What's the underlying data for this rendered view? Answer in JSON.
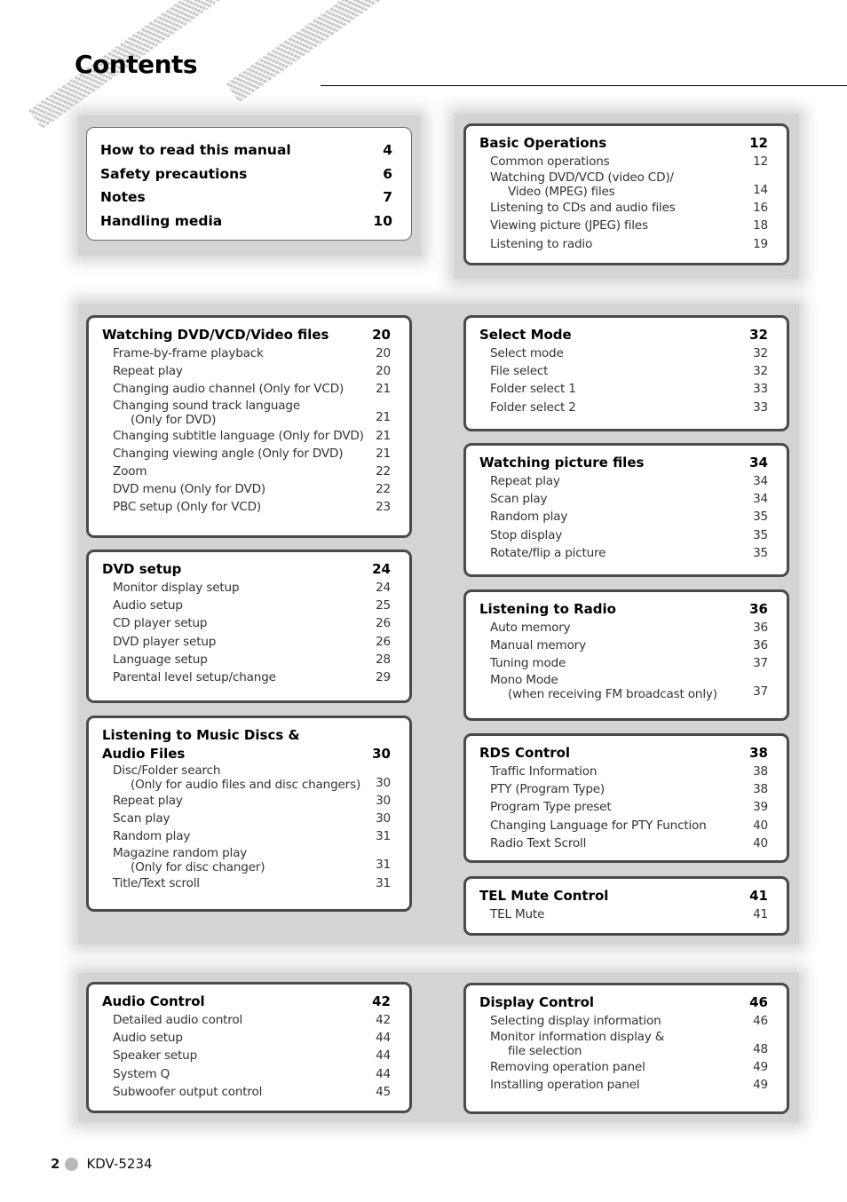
{
  "page": {
    "title": "Contents",
    "footer": {
      "page_number": "2",
      "model": "KDV-5234"
    }
  },
  "intro": [
    {
      "label": "How to read this manual",
      "page": "4"
    },
    {
      "label": "Safety precautions",
      "page": "6"
    },
    {
      "label": "Notes",
      "page": "7"
    },
    {
      "label": "Handling media",
      "page": "10"
    }
  ],
  "sections": {
    "basic": {
      "title": "Basic Operations",
      "page": "12",
      "items": [
        {
          "label": "Common operations",
          "page": "12"
        },
        {
          "label": "Watching DVD/VCD (video CD)/",
          "sub": "Video (MPEG) files",
          "page": "14"
        },
        {
          "label": "Listening to CDs and audio files",
          "page": "16"
        },
        {
          "label": "Viewing picture (JPEG) files",
          "page": "18"
        },
        {
          "label": "Listening to radio",
          "page": "19"
        }
      ]
    },
    "watching_dvd": {
      "title": "Watching DVD/VCD/Video files",
      "page": "20",
      "items": [
        {
          "label": "Frame-by-frame playback",
          "page": "20"
        },
        {
          "label": "Repeat play",
          "page": "20"
        },
        {
          "label": "Changing audio channel (Only for VCD)",
          "page": "21"
        },
        {
          "label": "Changing sound track language",
          "sub": "(Only for DVD)",
          "page": "21"
        },
        {
          "label": "Changing subtitle language (Only for DVD)",
          "page": "21"
        },
        {
          "label": "Changing viewing angle (Only for DVD)",
          "page": "21"
        },
        {
          "label": "Zoom",
          "page": "22"
        },
        {
          "label": "DVD menu (Only for DVD)",
          "page": "22"
        },
        {
          "label": "PBC setup (Only for VCD)",
          "page": "23"
        }
      ]
    },
    "dvd_setup": {
      "title": "DVD setup",
      "page": "24",
      "items": [
        {
          "label": "Monitor display setup",
          "page": "24"
        },
        {
          "label": "Audio setup",
          "page": "25"
        },
        {
          "label": "CD player setup",
          "page": "26"
        },
        {
          "label": "DVD player setup",
          "page": "26"
        },
        {
          "label": "Language setup",
          "page": "28"
        },
        {
          "label": "Parental level setup/change",
          "page": "29"
        }
      ]
    },
    "music": {
      "title_line1": "Listening to Music Discs &",
      "title": "Audio Files",
      "page": "30",
      "items": [
        {
          "label": "Disc/Folder search",
          "sub": "(Only for audio files and disc changers)",
          "page": "30"
        },
        {
          "label": "Repeat play",
          "page": "30"
        },
        {
          "label": "Scan play",
          "page": "30"
        },
        {
          "label": "Random play",
          "page": "31"
        },
        {
          "label": "Magazine random play",
          "sub": "(Only for disc changer)",
          "page": "31"
        },
        {
          "label": "Title/Text scroll",
          "page": "31"
        }
      ]
    },
    "select_mode": {
      "title": "Select Mode",
      "page": "32",
      "items": [
        {
          "label": "Select mode",
          "page": "32"
        },
        {
          "label": "File select",
          "page": "32"
        },
        {
          "label": "Folder select 1",
          "page": "33"
        },
        {
          "label": "Folder select 2",
          "page": "33"
        }
      ]
    },
    "picture": {
      "title": "Watching picture files",
      "page": "34",
      "items": [
        {
          "label": "Repeat play",
          "page": "34"
        },
        {
          "label": "Scan play",
          "page": "34"
        },
        {
          "label": "Random play",
          "page": "35"
        },
        {
          "label": "Stop display",
          "page": "35"
        },
        {
          "label": "Rotate/flip a picture",
          "page": "35"
        }
      ]
    },
    "radio": {
      "title": "Listening to Radio",
      "page": "36",
      "items": [
        {
          "label": "Auto memory",
          "page": "36"
        },
        {
          "label": "Manual memory",
          "page": "36"
        },
        {
          "label": "Tuning mode",
          "page": "37"
        },
        {
          "label": "Mono Mode",
          "sub": "(when receiving FM broadcast only)",
          "page": "37"
        }
      ]
    },
    "rds": {
      "title": "RDS Control",
      "page": "38",
      "items": [
        {
          "label": "Traffic Information",
          "page": "38"
        },
        {
          "label": "PTY (Program Type)",
          "page": "38"
        },
        {
          "label": "Program Type preset",
          "page": "39"
        },
        {
          "label": "Changing Language for PTY Function",
          "page": "40"
        },
        {
          "label": "Radio Text Scroll",
          "page": "40"
        }
      ]
    },
    "tel": {
      "title": "TEL Mute Control",
      "page": "41",
      "items": [
        {
          "label": "TEL Mute",
          "page": "41"
        }
      ]
    },
    "audio": {
      "title": "Audio Control",
      "page": "42",
      "items": [
        {
          "label": "Detailed audio control",
          "page": "42"
        },
        {
          "label": "Audio setup",
          "page": "44"
        },
        {
          "label": "Speaker setup",
          "page": "44"
        },
        {
          "label": "System Q",
          "page": "44"
        },
        {
          "label": "Subwoofer output control",
          "page": "45"
        }
      ]
    },
    "display": {
      "title": "Display Control",
      "page": "46",
      "items": [
        {
          "label": "Selecting display information",
          "page": "46"
        },
        {
          "label": "Monitor information display &",
          "sub": "file selection",
          "page": "48"
        },
        {
          "label": "Removing operation panel",
          "page": "49"
        },
        {
          "label": "Installing operation panel",
          "page": "49"
        }
      ]
    }
  }
}
